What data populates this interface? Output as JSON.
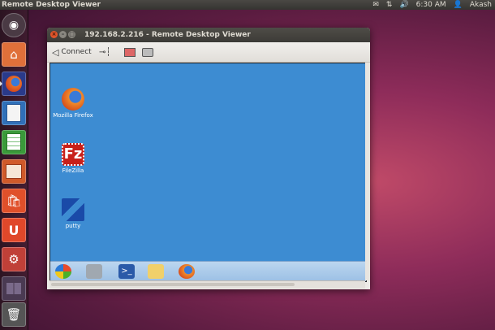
{
  "top_panel": {
    "title": "Remote Desktop Viewer",
    "time": "6:30 AM",
    "user": "Akash",
    "icons": [
      "mail-icon",
      "network-icon",
      "volume-icon",
      "user-icon"
    ]
  },
  "launcher": {
    "items": [
      {
        "name": "dash-home",
        "icon": "ubuntu-logo-icon",
        "color": "#5a4a52"
      },
      {
        "name": "files",
        "icon": "home-folder-icon",
        "color": "#e0703a"
      },
      {
        "name": "firefox",
        "icon": "firefox-icon",
        "color": "#e06a2a"
      },
      {
        "name": "writer",
        "icon": "writer-icon",
        "color": "#2f6db8"
      },
      {
        "name": "calc",
        "icon": "calc-icon",
        "color": "#3a9a3a"
      },
      {
        "name": "impress",
        "icon": "impress-icon",
        "color": "#d05a2a"
      },
      {
        "name": "software-center",
        "icon": "shopping-bag-icon",
        "color": "#e0502a"
      },
      {
        "name": "ubuntu-one",
        "icon": "ubuntu-one-icon",
        "color": "#e0482a"
      },
      {
        "name": "system-settings",
        "icon": "settings-icon",
        "color": "#c04038"
      },
      {
        "name": "workspaces",
        "icon": "workspace-switcher-icon",
        "color": "#5a4a60"
      },
      {
        "name": "trash",
        "icon": "trash-icon",
        "color": "#6a6a6a"
      }
    ]
  },
  "window": {
    "title": "192.168.2.216 - Remote Desktop Viewer",
    "toolbar": {
      "connect_label": "Connect"
    }
  },
  "remote_desktop": {
    "background": "#3d8cd2",
    "icons": [
      {
        "label": "Mozilla Firefox",
        "icon": "firefox-icon"
      },
      {
        "label": "FileZilla",
        "icon": "filezilla-icon"
      },
      {
        "label": "putty",
        "icon": "putty-icon"
      }
    ],
    "taskbar": [
      "start-orb-icon",
      "computer-icon",
      "powershell-icon",
      "explorer-folder-icon",
      "firefox-icon"
    ]
  }
}
